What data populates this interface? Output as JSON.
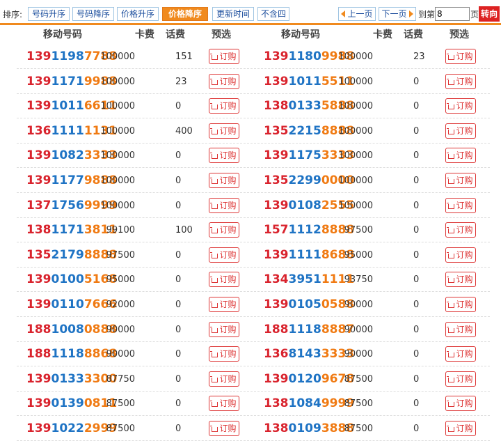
{
  "toolbar": {
    "sort_label": "排序:",
    "sorts": [
      "号码升序",
      "号码降序",
      "价格升序",
      "价格降序",
      "更新时间",
      "不含四"
    ],
    "active_sort": 3,
    "prev": "上一页",
    "next": "下一页",
    "goto_prefix": "到第",
    "page_value": "8",
    "goto_suffix": "页",
    "go": "转向"
  },
  "headers": {
    "number": "移动号码",
    "price": "卡费",
    "fee": "话费",
    "action": "预选"
  },
  "order_label": "订购",
  "colors": {
    "prefix": "#d9232d",
    "middle": "#1e73c4",
    "tail": "#f07a12",
    "accent": "#f08a1e"
  },
  "rows": [
    {
      "left": {
        "n": [
          "139",
          "1198",
          "7788"
        ],
        "price": "100000",
        "fee": "151"
      },
      "right": {
        "n": [
          "139",
          "1180",
          "9988"
        ],
        "price": "100000",
        "fee": "23"
      }
    },
    {
      "left": {
        "n": [
          "139",
          "1171",
          "9988"
        ],
        "price": "100000",
        "fee": "23"
      },
      "right": {
        "n": [
          "139",
          "1011",
          "5511"
        ],
        "price": "100000",
        "fee": "0"
      }
    },
    {
      "left": {
        "n": [
          "139",
          "1011",
          "6611"
        ],
        "price": "100000",
        "fee": "0"
      },
      "right": {
        "n": [
          "138",
          "0133",
          "5888"
        ],
        "price": "100000",
        "fee": "0"
      }
    },
    {
      "left": {
        "n": [
          "136",
          "1111",
          "1131"
        ],
        "price": "100000",
        "fee": "400"
      },
      "right": {
        "n": [
          "135",
          "2215",
          "8888"
        ],
        "price": "100000",
        "fee": "0"
      }
    },
    {
      "left": {
        "n": [
          "139",
          "1082",
          "3333"
        ],
        "price": "100000",
        "fee": "0"
      },
      "right": {
        "n": [
          "139",
          "1175",
          "3333"
        ],
        "price": "100000",
        "fee": "0"
      }
    },
    {
      "left": {
        "n": [
          "139",
          "1177",
          "9888"
        ],
        "price": "100000",
        "fee": "0"
      },
      "right": {
        "n": [
          "135",
          "2299",
          "0000"
        ],
        "price": "100000",
        "fee": "0"
      }
    },
    {
      "left": {
        "n": [
          "137",
          "1756",
          "9999"
        ],
        "price": "100000",
        "fee": "0"
      },
      "right": {
        "n": [
          "139",
          "0108",
          "2555"
        ],
        "price": "100000",
        "fee": "0"
      }
    },
    {
      "left": {
        "n": [
          "138",
          "1171",
          "3811"
        ],
        "price": "99100",
        "fee": "100"
      },
      "right": {
        "n": [
          "157",
          "1112",
          "8888"
        ],
        "price": "97500",
        "fee": "0"
      }
    },
    {
      "left": {
        "n": [
          "135",
          "2179",
          "8888"
        ],
        "price": "97500",
        "fee": "0"
      },
      "right": {
        "n": [
          "139",
          "1111",
          "8688"
        ],
        "price": "95000",
        "fee": "0"
      }
    },
    {
      "left": {
        "n": [
          "139",
          "0100",
          "5168"
        ],
        "price": "95000",
        "fee": "0"
      },
      "right": {
        "n": [
          "134",
          "3951",
          "1111"
        ],
        "price": "93750",
        "fee": "0"
      }
    },
    {
      "left": {
        "n": [
          "139",
          "0110",
          "7666"
        ],
        "price": "92000",
        "fee": "0"
      },
      "right": {
        "n": [
          "139",
          "0105",
          "0588"
        ],
        "price": "90000",
        "fee": "0"
      }
    },
    {
      "left": {
        "n": [
          "188",
          "1008",
          "0888"
        ],
        "price": "90000",
        "fee": "0"
      },
      "right": {
        "n": [
          "188",
          "1118",
          "8887"
        ],
        "price": "90000",
        "fee": "0"
      }
    },
    {
      "left": {
        "n": [
          "188",
          "1118",
          "8868"
        ],
        "price": "90000",
        "fee": "0"
      },
      "right": {
        "n": [
          "136",
          "8143",
          "3333"
        ],
        "price": "90000",
        "fee": "0"
      }
    },
    {
      "left": {
        "n": [
          "139",
          "0133",
          "3300"
        ],
        "price": "87750",
        "fee": "0"
      },
      "right": {
        "n": [
          "139",
          "0120",
          "9678"
        ],
        "price": "87500",
        "fee": "0"
      }
    },
    {
      "left": {
        "n": [
          "139",
          "0139",
          "0811"
        ],
        "price": "87500",
        "fee": "0"
      },
      "right": {
        "n": [
          "138",
          "1084",
          "9999"
        ],
        "price": "87500",
        "fee": "0"
      }
    },
    {
      "left": {
        "n": [
          "139",
          "1022",
          "2999"
        ],
        "price": "87500",
        "fee": "0"
      },
      "right": {
        "n": [
          "138",
          "0109",
          "3888"
        ],
        "price": "87500",
        "fee": "0"
      }
    }
  ]
}
